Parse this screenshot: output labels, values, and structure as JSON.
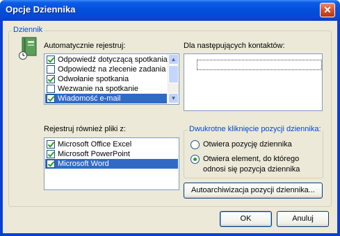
{
  "window": {
    "title": "Opcje Dziennika",
    "close_symbol": "✕"
  },
  "journal_group": {
    "legend": "Dziennik",
    "auto_record_label": "Automatycznie rejestruj:",
    "auto_record_items": [
      {
        "label": "Odpowiedź dotyczącą spotkania",
        "checked": true,
        "selected": false
      },
      {
        "label": "Odpowiedź na zlecenie zadania",
        "checked": false,
        "selected": false
      },
      {
        "label": "Odwołanie spotkania",
        "checked": true,
        "selected": false
      },
      {
        "label": "Wezwanie na spotkanie",
        "checked": false,
        "selected": false
      },
      {
        "label": "Wiadomość e-mail",
        "checked": true,
        "selected": true
      }
    ],
    "contacts_label": "Dla następujących kontaktów:",
    "files_label": "Rejestruj również pliki z:",
    "files_items": [
      {
        "label": "Microsoft Office Excel",
        "checked": true,
        "selected": false
      },
      {
        "label": "Microsoft PowerPoint",
        "checked": true,
        "selected": false
      },
      {
        "label": "Microsoft Word",
        "checked": true,
        "selected": true
      }
    ],
    "double_click": {
      "legend": "Dwukrotne kliknięcie pozycji dziennika:",
      "option_open_entry": "Otwiera pozycję dziennika",
      "option_open_item_line1": "Otwiera element, do którego",
      "option_open_item_line2": "odnosi się pozycja dziennika",
      "selected": "open_item"
    },
    "autoarchive_label": "Autoarchiwizacja pozycji dziennika..."
  },
  "footer": {
    "ok_label": "OK",
    "cancel_label": "Anuluj"
  },
  "icons": {
    "journal": "journal-book-icon",
    "close": "close-icon",
    "scroll_up": "scroll-up-arrow-icon",
    "scroll_down": "scroll-down-arrow-icon"
  },
  "colors": {
    "titlebar": "#0350dc",
    "dialog_bg": "#ece9d8",
    "selection": "#316ac5",
    "legend_text": "#0046d5",
    "close_button": "#d2502a"
  }
}
